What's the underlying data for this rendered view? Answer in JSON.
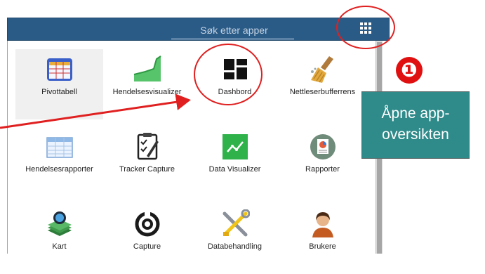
{
  "search": {
    "placeholder": "Søk etter apper"
  },
  "apps": [
    {
      "label": "Pivottabell",
      "icon": "pivot-table-icon"
    },
    {
      "label": "Hendelsesvisualizer",
      "icon": "event-visualizer-icon"
    },
    {
      "label": "Dashbord",
      "icon": "dashboard-icon"
    },
    {
      "label": "Nettleserbufferrens",
      "icon": "browser-cache-cleaner-icon"
    },
    {
      "label": "Hendelsesrapporter",
      "icon": "event-reports-icon"
    },
    {
      "label": "Tracker Capture",
      "icon": "tracker-capture-icon"
    },
    {
      "label": "Data Visualizer",
      "icon": "data-visualizer-icon"
    },
    {
      "label": "Rapporter",
      "icon": "reports-icon"
    },
    {
      "label": "Kart",
      "icon": "maps-icon"
    },
    {
      "label": "Capture",
      "icon": "capture-icon"
    },
    {
      "label": "Databehandling",
      "icon": "data-administration-icon"
    },
    {
      "label": "Brukere",
      "icon": "users-icon"
    }
  ],
  "annotation": {
    "step_number": "❶",
    "tooltip_line1": "Åpne app-",
    "tooltip_line2": "oversikten"
  },
  "colors": {
    "header": "#2a5b87",
    "highlight": "#e02020",
    "tooltip": "#2f8a8a"
  }
}
